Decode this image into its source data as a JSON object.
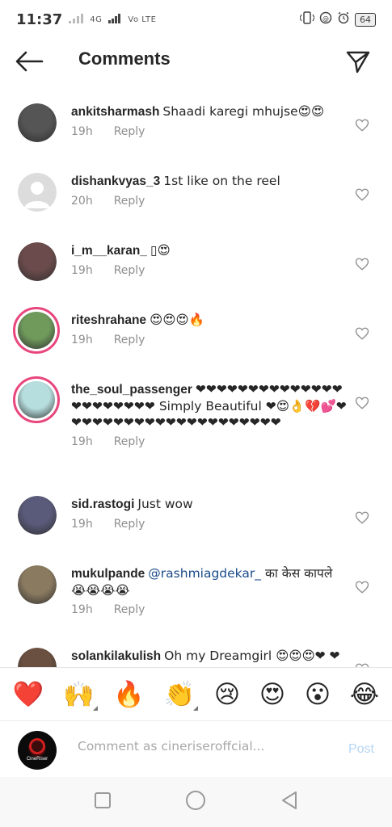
{
  "status": {
    "time": "11:37",
    "network": "4G",
    "volte": "Vo LTE",
    "battery": "64",
    "icons": [
      "signal-icon",
      "vibrate-icon",
      "data-saver-icon",
      "alarm-icon",
      "battery-icon"
    ]
  },
  "header": {
    "title": "Comments"
  },
  "comments": [
    {
      "username": "ankitsharmash",
      "text": "Shaadi karegi mhujse😍😍",
      "mention": "",
      "time": "19h",
      "reply": "Reply",
      "avatar_color": "#555555",
      "ring": false
    },
    {
      "username": "dishankvyas_3",
      "text": "1st like on the reel",
      "mention": "",
      "time": "20h",
      "reply": "Reply",
      "avatar_color": "#dcdcdc",
      "ring": false,
      "default_avatar": true
    },
    {
      "username": "i_m__karan_",
      "text": "▯😍",
      "mention": "",
      "time": "19h",
      "reply": "Reply",
      "avatar_color": "#6b4b4b",
      "ring": false
    },
    {
      "username": "riteshrahane",
      "text": "😍😍😍🔥",
      "mention": "",
      "time": "19h",
      "reply": "Reply",
      "avatar_color": "#6f9a5c",
      "ring": true
    },
    {
      "username": "the_soul_passenger",
      "text": "❤❤❤❤❤❤❤❤❤❤❤❤❤❤❤❤❤❤❤❤❤❤ Simply Beautiful ❤😍👌💔💕❤❤❤❤❤❤❤❤❤❤❤❤❤❤❤❤❤❤❤❤❤",
      "mention": "",
      "time": "19h",
      "reply": "Reply",
      "avatar_color": "#b7dede",
      "ring": true
    },
    {
      "username": "sid.rastogi",
      "text": "Just wow",
      "mention": "",
      "time": "19h",
      "reply": "Reply",
      "avatar_color": "#5a5a7a",
      "ring": false
    },
    {
      "username": "mukulpande",
      "text": "का केस कापले 😭😭😭😭",
      "mention": "@rashmiagdekar_",
      "time": "19h",
      "reply": "Reply",
      "avatar_color": "#8a7a60",
      "ring": false
    },
    {
      "username": "solankilakulish",
      "text": "Oh my Dreamgirl 😍😍😍❤ ❤❤❤❤",
      "mention": "",
      "time": "",
      "reply": "",
      "avatar_color": "#6a5040",
      "ring": false
    }
  ],
  "reactions": [
    {
      "emoji": "❤️",
      "name": "heart"
    },
    {
      "emoji": "🙌",
      "name": "raised-hands"
    },
    {
      "emoji": "🔥",
      "name": "fire"
    },
    {
      "emoji": "👏",
      "name": "clapping"
    },
    {
      "emoji": "😢",
      "name": "crying"
    },
    {
      "emoji": "😍",
      "name": "heart-eyes"
    },
    {
      "emoji": "😮",
      "name": "surprised"
    },
    {
      "emoji": "😂",
      "name": "laughing"
    }
  ],
  "input": {
    "placeholder": "Comment as cineriseroffcial...",
    "post_label": "Post",
    "avatar_brand": "CineRiser"
  },
  "colors": {
    "accent": "#e8467c",
    "link": "#1b4b8a",
    "muted": "#8e8e8e",
    "post_disabled": "#b6d6f4"
  }
}
